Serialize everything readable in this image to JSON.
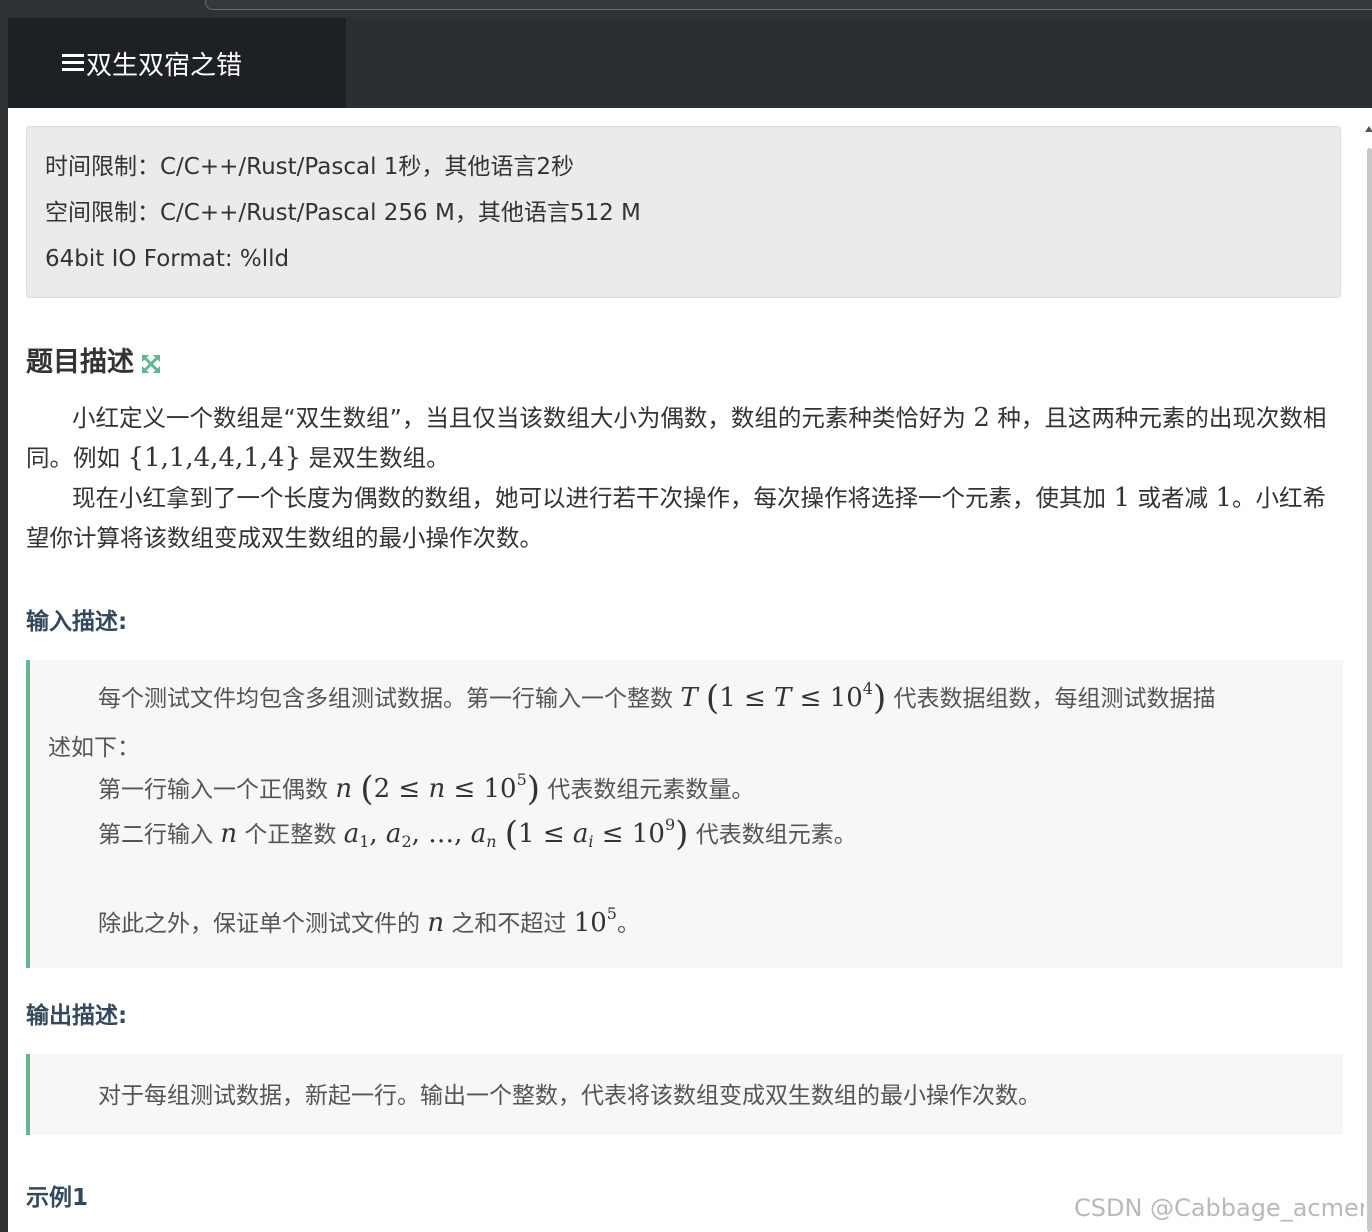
{
  "header": {
    "title": "双生双宿之错"
  },
  "limits": {
    "time": "时间限制：C/C++/Rust/Pascal 1秒，其他语言2秒",
    "space": "空间限制：C/C++/Rust/Pascal 256 M，其他语言512 M",
    "io_format": "64bit IO Format: %lld"
  },
  "description": {
    "title": "题目描述",
    "p1_part1": "小红定义一个数组是“双生数组”，当且仅当该数组大小为偶数，数组的元素种类恰好为 ",
    "p1_math1": "2",
    "p1_part2": " 种，且这两种元素的出现次数相同。例如 ",
    "p1_math2": "{1,1,4,4,1,4}",
    "p1_part3": " 是双生数组。",
    "p2_part1": "现在小红拿到了一个长度为偶数的数组，她可以进行若干次操作，每次操作将选择一个元素，使其加 ",
    "p2_math1": "1",
    "p2_part2": " 或者减 ",
    "p2_math2": "1",
    "p2_part3": "。小红希望你计算将该数组变成双生数组的最小操作次数。"
  },
  "input": {
    "title": "输入描述:",
    "l1a": "每个测试文件均包含多组测试数据。第一行输入一个整数 ",
    "l1b": " 代表数据组数，每组测试数据描",
    "l2": "述如下：",
    "l3a": "第一行输入一个正偶数 ",
    "l3b": " 代表数组元素数量。",
    "l4a": "第二行输入 ",
    "l4b": " 个正整数 ",
    "l4c": " 代表数组元素。",
    "l5a": "除此之外，保证单个测试文件的 ",
    "l5b": " 之和不超过 ",
    "l5c": "。"
  },
  "output": {
    "title": "输出描述:",
    "text": "对于每组测试数据，新起一行。输出一个整数，代表将该数组变成双生数组的最小操作次数。"
  },
  "example": {
    "title": "示例1"
  },
  "watermark": "CSDN @Cabbage_acmer"
}
